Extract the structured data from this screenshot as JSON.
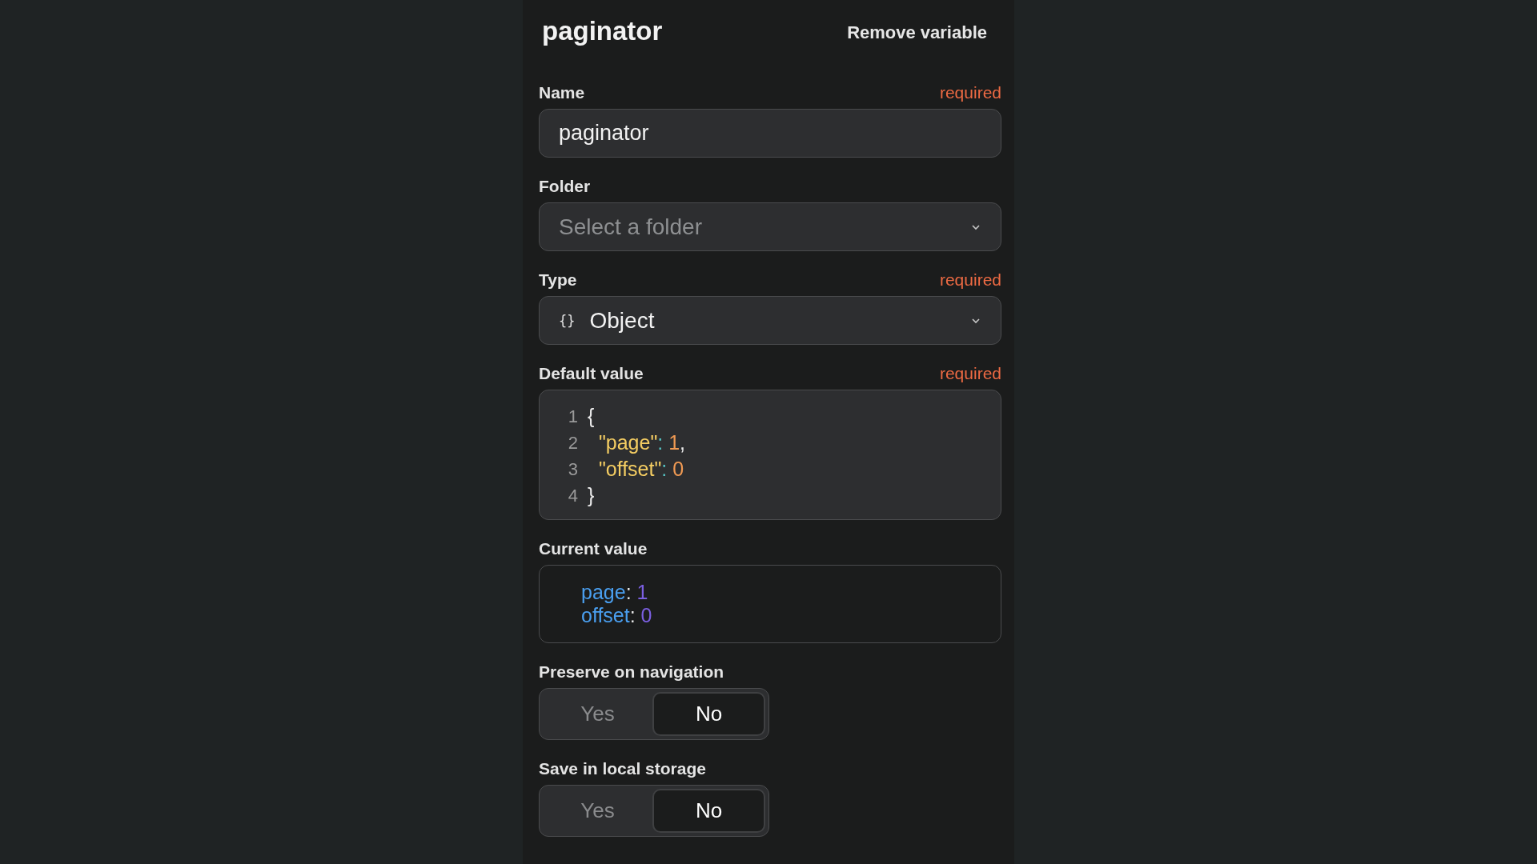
{
  "title": "paginator",
  "remove_button": "Remove variable",
  "fields": [
    {
      "kind": "text",
      "label": "Name",
      "required": "required",
      "value": "paginator"
    },
    {
      "kind": "select",
      "label": "Folder",
      "placeholder": "Select a folder"
    },
    {
      "kind": "select",
      "label": "Type",
      "required": "required",
      "value": "Object",
      "icon": "{}"
    },
    {
      "kind": "code",
      "label": "Default value",
      "required": "required",
      "lines": [
        {
          "number": "1",
          "tokens": [
            {
              "kind": "plain",
              "text": "{"
            }
          ]
        },
        {
          "number": "2",
          "tokens": [
            {
              "kind": "key",
              "text": "  \"page\""
            },
            {
              "kind": "colon",
              "text": ":"
            },
            {
              "kind": "number",
              "text": " 1"
            },
            {
              "kind": "plain",
              "text": ","
            }
          ]
        },
        {
          "number": "3",
          "tokens": [
            {
              "kind": "key",
              "text": "  \"offset\""
            },
            {
              "kind": "colon",
              "text": ":"
            },
            {
              "kind": "number",
              "text": " 0"
            }
          ]
        },
        {
          "number": "4",
          "tokens": [
            {
              "kind": "plain",
              "text": "}"
            }
          ]
        }
      ]
    },
    {
      "kind": "value",
      "label": "Current value",
      "entries": [
        {
          "key": "page",
          "colon": ":",
          "value": "1"
        },
        {
          "key": "offset",
          "colon": ":",
          "value": "0"
        }
      ]
    },
    {
      "kind": "toggle",
      "label": "Preserve on navigation",
      "options": [
        {
          "label": "Yes",
          "selected": false
        },
        {
          "label": "No",
          "selected": true
        }
      ]
    },
    {
      "kind": "toggle",
      "label": "Save in local storage",
      "options": [
        {
          "label": "Yes",
          "selected": false
        },
        {
          "label": "No",
          "selected": true
        }
      ]
    }
  ]
}
